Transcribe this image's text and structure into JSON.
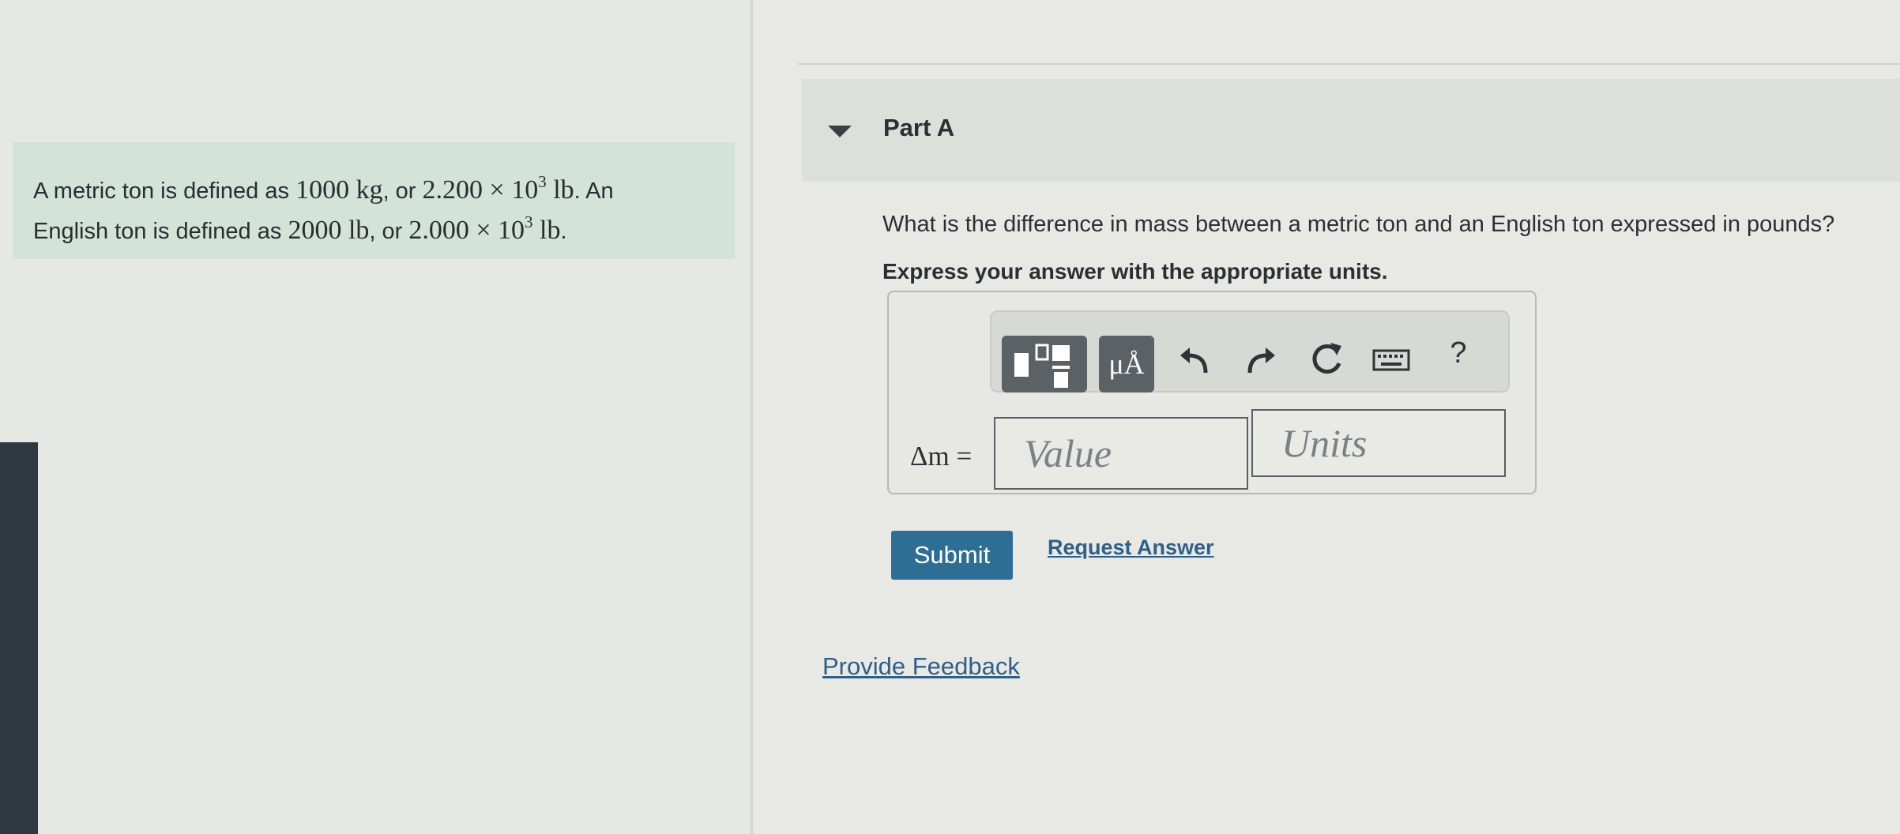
{
  "problem": {
    "text_1": "A metric ton is defined as ",
    "math_1": "1000 kg",
    "text_2": ", or ",
    "math_2_base": "2.200 × 10",
    "math_2_exp": "3",
    "math_2_unit": " lb",
    "text_3": ". An",
    "text_4": "English ton is defined as ",
    "math_3": "2000 lb",
    "text_5": ", or ",
    "math_4_base": "2.000 × 10",
    "math_4_exp": "3",
    "math_4_unit": " lb",
    "text_6": "."
  },
  "part": {
    "title": "Part A",
    "expanded": true
  },
  "question": "What is the difference in mass between a metric ton and an English ton expressed in pounds?",
  "instruction": "Express your answer with the appropriate units.",
  "toolbar": {
    "units_button_label": "μÅ",
    "help_label": "?",
    "icons": [
      "fraction-template-icon",
      "units-icon",
      "undo-icon",
      "redo-icon",
      "reset-icon",
      "keyboard-icon",
      "help-icon"
    ]
  },
  "answer": {
    "variable_label": "Δm =",
    "value_placeholder": "Value",
    "units_placeholder": "Units"
  },
  "actions": {
    "submit_label": "Submit",
    "request_answer_label": "Request Answer"
  },
  "feedback_label": "Provide Feedback",
  "colors": {
    "problem_background": "#d3e3da",
    "submit_background": "#2f6e94",
    "link": "#2f5f88"
  }
}
